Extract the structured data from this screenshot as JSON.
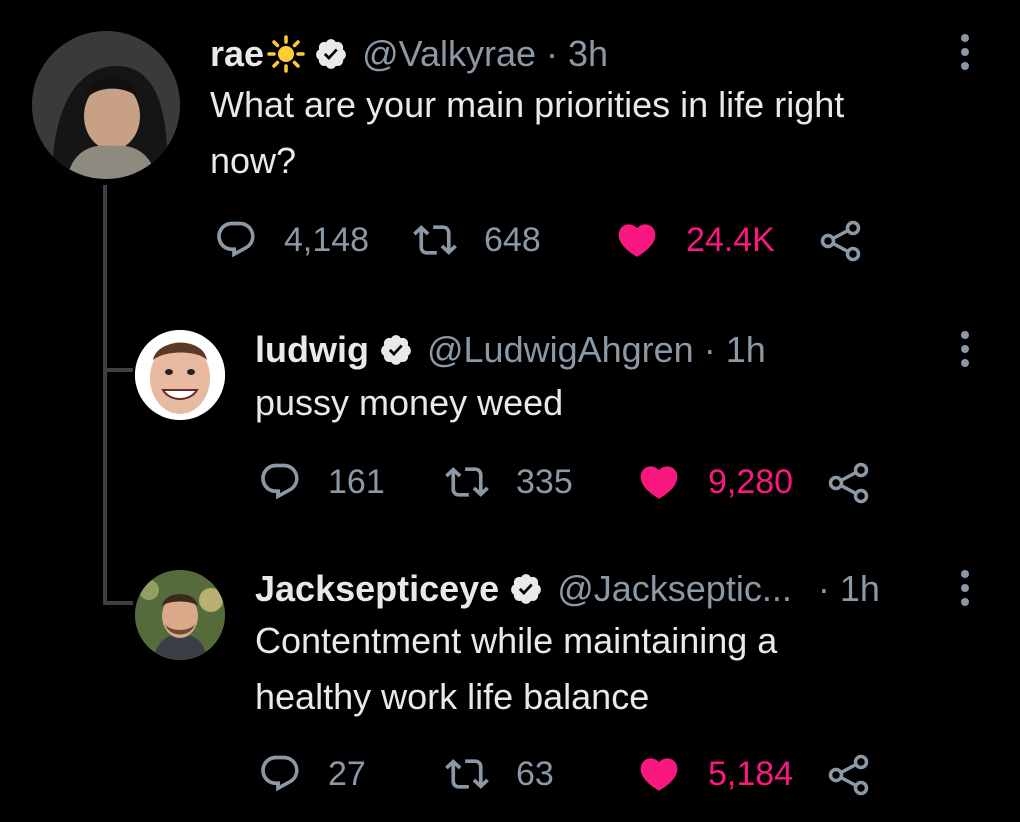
{
  "tweets": [
    {
      "name": "rae",
      "handle": "@Valkyrae",
      "time": "· 3h",
      "text_line1": "What are your main priorities in life right",
      "text_line2": "now?",
      "replies": "4,148",
      "retweets": "648",
      "likes": "24.4K",
      "emoji": "sun-emoji"
    },
    {
      "name": "ludwig",
      "handle": "@LudwigAhgren",
      "time": "· 1h",
      "text_line1": "pussy money weed",
      "replies": "161",
      "retweets": "335",
      "likes": "9,280"
    },
    {
      "name": "Jacksepticeye",
      "handle": "@Jackseptic...",
      "time": "· 1h",
      "text_line1": "Contentment while maintaining a",
      "text_line2": "healthy work life balance",
      "replies": "27",
      "retweets": "63",
      "likes": "5,184"
    }
  ],
  "colors": {
    "background": "#000000",
    "text": "#e7e9ea",
    "muted": "#8b98a5",
    "like": "#f91880",
    "sun": "#ffcc33"
  }
}
